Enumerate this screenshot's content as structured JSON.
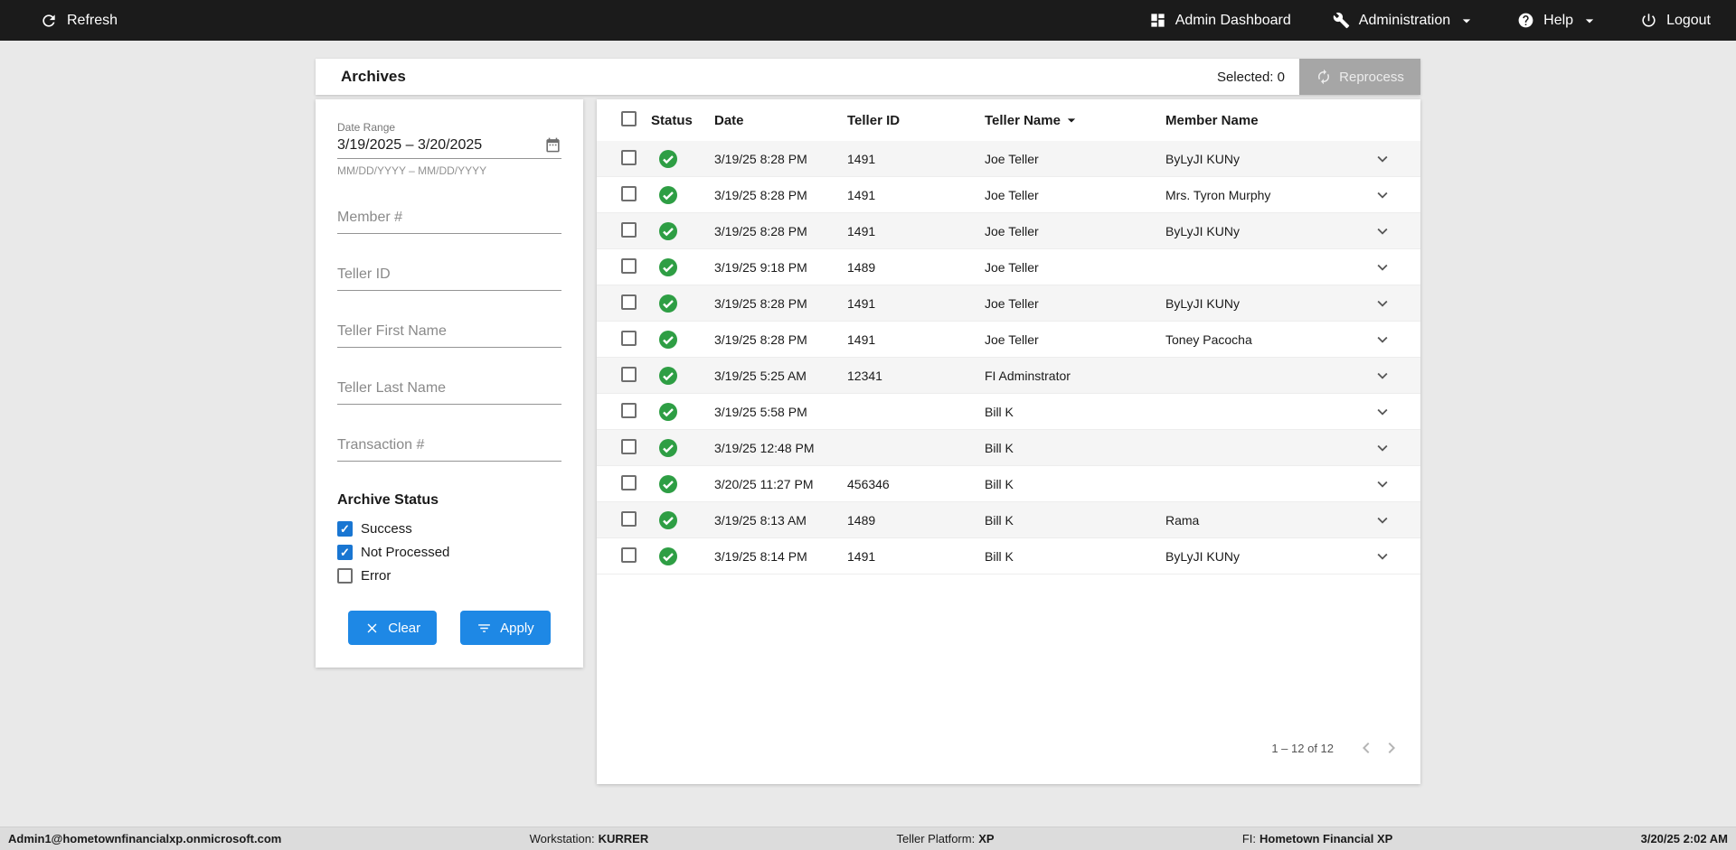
{
  "colors": {
    "topbar_bg": "#1b1b1b",
    "page_bg": "#e9e9e9",
    "statusbar_bg": "#dcdcdc",
    "accent_blue": "#1e88e5",
    "checkbox_blue": "#1976d2",
    "success_green": "#2e9e44",
    "disabled_button_bg": "#a6a6a6"
  },
  "topbar": {
    "refresh": "Refresh",
    "admin_dashboard": "Admin Dashboard",
    "administration": "Administration",
    "help": "Help",
    "logout": "Logout"
  },
  "header": {
    "title": "Archives",
    "selected_label": "Selected: 0",
    "reprocess_label": "Reprocess"
  },
  "filters": {
    "date_range": {
      "label": "Date Range",
      "value": "3/19/2025 – 3/20/2025",
      "helper": "MM/DD/YYYY – MM/DD/YYYY"
    },
    "fields": [
      {
        "placeholder": "Member #"
      },
      {
        "placeholder": "Teller ID"
      },
      {
        "placeholder": "Teller First Name"
      },
      {
        "placeholder": "Teller Last Name"
      },
      {
        "placeholder": "Transaction #"
      }
    ],
    "archive_status": {
      "label": "Archive Status",
      "options": [
        {
          "label": "Success",
          "checked": true
        },
        {
          "label": "Not Processed",
          "checked": true
        },
        {
          "label": "Error",
          "checked": false
        }
      ]
    },
    "clear_label": "Clear",
    "apply_label": "Apply"
  },
  "table": {
    "columns": [
      "Status",
      "Date",
      "Teller ID",
      "Teller Name",
      "Member Name"
    ],
    "sort_column": "Teller Name",
    "rows": [
      {
        "status": "success",
        "date": "3/19/25 8:28 PM",
        "teller_id": "1491",
        "teller_name": "Joe Teller",
        "member_name": "ByLyJI KUNy"
      },
      {
        "status": "success",
        "date": "3/19/25 8:28 PM",
        "teller_id": "1491",
        "teller_name": "Joe Teller",
        "member_name": "Mrs. Tyron Murphy"
      },
      {
        "status": "success",
        "date": "3/19/25 8:28 PM",
        "teller_id": "1491",
        "teller_name": "Joe Teller",
        "member_name": "ByLyJI KUNy"
      },
      {
        "status": "success",
        "date": "3/19/25 9:18 PM",
        "teller_id": "1489",
        "teller_name": "Joe Teller",
        "member_name": ""
      },
      {
        "status": "success",
        "date": "3/19/25 8:28 PM",
        "teller_id": "1491",
        "teller_name": "Joe Teller",
        "member_name": "ByLyJI KUNy"
      },
      {
        "status": "success",
        "date": "3/19/25 8:28 PM",
        "teller_id": "1491",
        "teller_name": "Joe Teller",
        "member_name": "Toney Pacocha"
      },
      {
        "status": "success",
        "date": "3/19/25 5:25 AM",
        "teller_id": "12341",
        "teller_name": "FI Adminstrator",
        "member_name": ""
      },
      {
        "status": "success",
        "date": "3/19/25 5:58 PM",
        "teller_id": "",
        "teller_name": "Bill K",
        "member_name": ""
      },
      {
        "status": "success",
        "date": "3/19/25 12:48 PM",
        "teller_id": "",
        "teller_name": "Bill K",
        "member_name": ""
      },
      {
        "status": "success",
        "date": "3/20/25 11:27 PM",
        "teller_id": "456346",
        "teller_name": "Bill K",
        "member_name": ""
      },
      {
        "status": "success",
        "date": "3/19/25 8:13 AM",
        "teller_id": "1489",
        "teller_name": "Bill K",
        "member_name": "Rama"
      },
      {
        "status": "success",
        "date": "3/19/25 8:14 PM",
        "teller_id": "1491",
        "teller_name": "Bill K",
        "member_name": "ByLyJI KUNy"
      }
    ],
    "pagination": {
      "range_label": "1 – 12 of 12"
    }
  },
  "footer": {
    "user": "Admin1@hometownfinancialxp.onmicrosoft.com",
    "workstation_label": "Workstation:",
    "workstation_value": "KURRER",
    "platform_label": "Teller Platform:",
    "platform_value": "XP",
    "fi_label": "FI:",
    "fi_value": "Hometown Financial XP",
    "datetime": "3/20/25 2:02 AM"
  }
}
